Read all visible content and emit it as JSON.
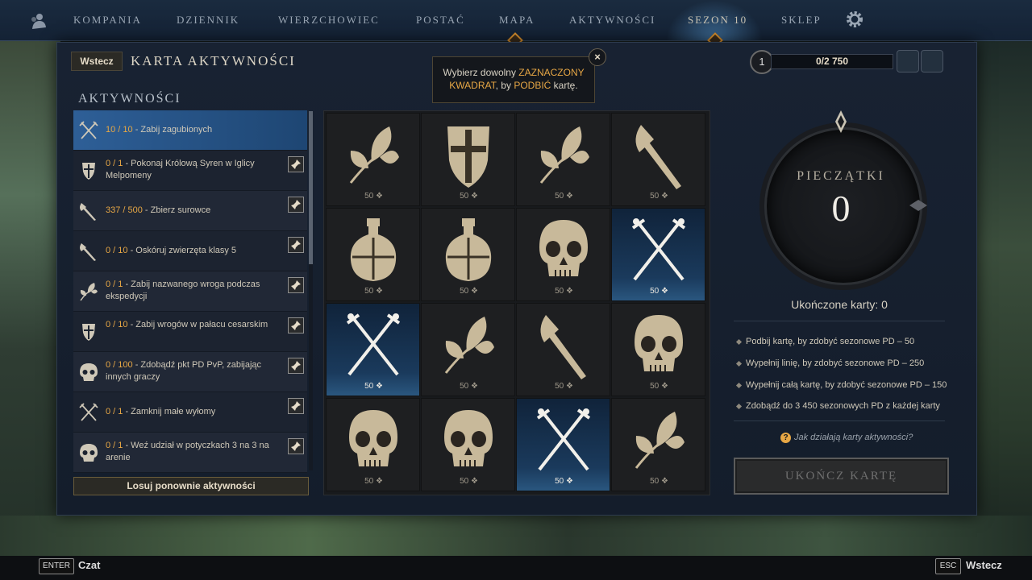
{
  "nav": {
    "items": [
      "KOMPANIA",
      "DZIENNIK",
      "WIERZCHOWIEC",
      "POSTAĆ",
      "MAPA",
      "AKTYWNOŚCI",
      "SEZON 10",
      "SKLEP"
    ]
  },
  "header": {
    "back_label": "Wstecz",
    "title": "KARTA AKTYWNOŚCI",
    "level": "1",
    "xp": "0/2 750"
  },
  "tooltip": {
    "line1_a": "Wybierz dowolny ",
    "line1_b": "ZAZNACZONY",
    "line2_a": "KWADRAT",
    "line2_b": ", by ",
    "line2_c": "PODBIĆ",
    "line2_d": " kartę.",
    "close": "×"
  },
  "activities": {
    "title": "AKTYWNOŚCI",
    "items": [
      {
        "progress": "10 / 10",
        "label": " - Zabij zagubionych",
        "icon": "crossed-swords-icon"
      },
      {
        "progress": "0 / 1",
        "label": " - Pokonaj Królową Syren w Iglicy Melpomeny",
        "icon": "shield-icon"
      },
      {
        "progress": "337 / 500",
        "label": " - Zbierz surowce",
        "icon": "axe-icon"
      },
      {
        "progress": "0 / 10",
        "label": " - Oskóruj zwierzęta klasy 5",
        "icon": "axe-icon"
      },
      {
        "progress": "0 / 1",
        "label": " - Zabij nazwanego wroga podczas ekspedycji",
        "icon": "leaf-icon"
      },
      {
        "progress": "0 / 10",
        "label": " - Zabij wrogów w pałacu cesarskim",
        "icon": "shield-icon"
      },
      {
        "progress": "0 / 100",
        "label": " - Zdobądź pkt PD PvP, zabijając innych graczy",
        "icon": "skull-icon"
      },
      {
        "progress": "0 / 1",
        "label": " - Zamknij małe wyłomy",
        "icon": "crossed-swords-icon"
      },
      {
        "progress": "0 / 1",
        "label": " - Weź udział w potyczkach 3 na 3 na arenie",
        "icon": "skull-icon"
      }
    ],
    "reroll_label": "Losuj ponownie aktywności"
  },
  "grid": {
    "cells": [
      {
        "icon": "leaf",
        "points": "50",
        "done": false
      },
      {
        "icon": "shield",
        "points": "50",
        "done": false
      },
      {
        "icon": "leaf",
        "points": "50",
        "done": false
      },
      {
        "icon": "axe",
        "points": "50",
        "done": false
      },
      {
        "icon": "flask",
        "points": "50",
        "done": false
      },
      {
        "icon": "flask",
        "points": "50",
        "done": false
      },
      {
        "icon": "skull",
        "points": "50",
        "done": false
      },
      {
        "icon": "swords",
        "points": "50",
        "done": true
      },
      {
        "icon": "swords",
        "points": "50",
        "done": true
      },
      {
        "icon": "leaf",
        "points": "50",
        "done": false
      },
      {
        "icon": "axe",
        "points": "50",
        "done": false
      },
      {
        "icon": "skull",
        "points": "50",
        "done": false
      },
      {
        "icon": "skull",
        "points": "50",
        "done": false
      },
      {
        "icon": "skull",
        "points": "50",
        "done": false
      },
      {
        "icon": "swords",
        "points": "50",
        "done": true
      },
      {
        "icon": "leaf",
        "points": "50",
        "done": false
      }
    ]
  },
  "stamps": {
    "label": "PIECZĄTKI",
    "count": "0",
    "completed": "Ukończone karty: 0"
  },
  "rewards": [
    "Podbij kartę, by zdobyć sezonowe PD – 50",
    "Wypełnij linię, by zdobyć sezonowe PD – 250",
    "Wypełnij całą kartę, by zdobyć sezonowe PD – 150",
    "Zdobądź do 3 450 sezonowych PD z każdej karty"
  ],
  "help_text": "Jak działają karty aktywności?",
  "complete_label": "UKOŃCZ KARTĘ",
  "footer": {
    "enter_key": "ENTER",
    "chat_label": "Czat",
    "esc_key": "ESC",
    "back_label": "Wstecz"
  },
  "colors": {
    "accent": "#e7a745",
    "selected_row": "#2e5f97",
    "completed_cell": "#1a3a5c"
  }
}
